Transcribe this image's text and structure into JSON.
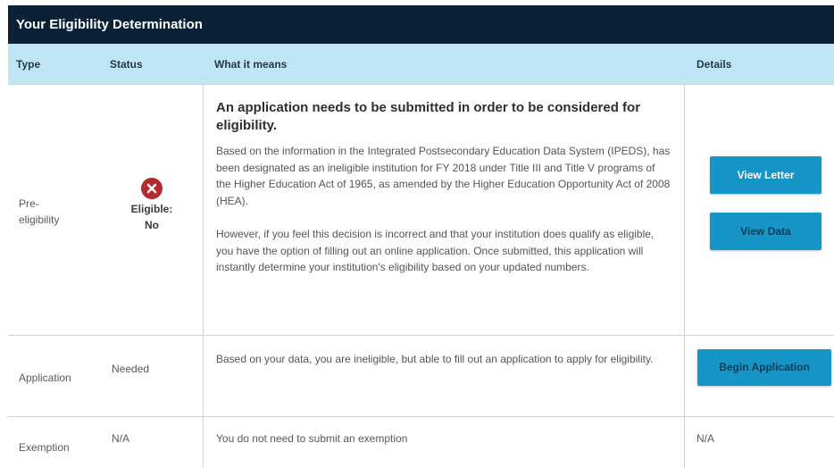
{
  "panel": {
    "title": "Your Eligibility Determination"
  },
  "table": {
    "headers": {
      "type": "Type",
      "status": "Status",
      "what": "What it means",
      "details": "Details"
    },
    "rows": [
      {
        "type": "Pre-\neligibility",
        "status_icon": "x-circle-icon",
        "status_label": "Eligible:",
        "status_value": "No",
        "heading": "An application needs to be submitted in order to be considered for eligibility.",
        "body_1": "Based on the information in the Integrated Postsecondary Education Data System (IPEDS), has been designated as an ineligible institution for FY 2018 under Title III and Title V programs of the Higher Education Act of 1965, as amended by the Higher Education Opportunity Act of 2008 (HEA).",
        "body_2": "However, if you feel this decision is incorrect and that your institution does qualify as eligible, you have the option of filling out an online application. Once submitted, this application will instantly determine your institution's eligibility based on your updated numbers.",
        "btn_letter": "View Letter",
        "btn_data": "View Data"
      },
      {
        "type": "Application",
        "status": "Needed",
        "body": "Based on your data, you are ineligible, but able to fill out an application to apply for eligibility.",
        "btn_begin": "Begin Application"
      },
      {
        "type": "Exemption",
        "status": "N/A",
        "body": "You do not need to submit an exemption",
        "details": "N/A"
      }
    ]
  },
  "colors": {
    "title_bg": "#0b2137",
    "header_bg": "#bfe6f5",
    "button": "#1795c6",
    "error_icon": "#b52a2f"
  }
}
